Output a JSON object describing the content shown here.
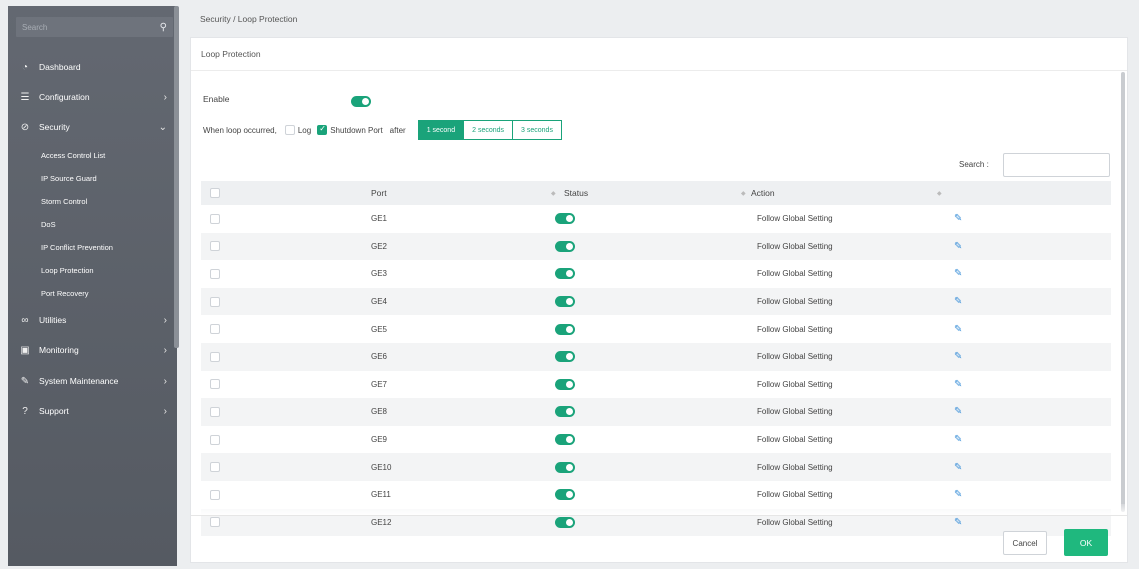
{
  "sidebar": {
    "search_placeholder": "Search",
    "items": [
      {
        "label": "Dashboard",
        "icon": "dashboard-icon",
        "glyph": "◔"
      },
      {
        "label": "Configuration",
        "icon": "sliders-icon",
        "glyph": "☰"
      },
      {
        "label": "Security",
        "icon": "shield-icon",
        "glyph": "⊘"
      },
      {
        "label": "Utilities",
        "icon": "utilities-icon",
        "glyph": "∞"
      },
      {
        "label": "Monitoring",
        "icon": "monitor-icon",
        "glyph": "▣"
      },
      {
        "label": "System Maintenance",
        "icon": "wrench-icon",
        "glyph": "✎"
      },
      {
        "label": "Support",
        "icon": "help-icon",
        "glyph": "?"
      }
    ],
    "security_sub": [
      "Access Control List",
      "IP Source Guard",
      "Storm Control",
      "DoS",
      "IP Conflict Prevention",
      "Loop Protection",
      "Port Recovery"
    ]
  },
  "breadcrumb": "Security / Loop Protection",
  "panel_title": "Loop Protection",
  "enable_label": "Enable",
  "loop": {
    "when_text": "When loop occurred,",
    "log_label": "Log",
    "shutdown_label": "Shutdown Port",
    "after_text": "after",
    "options": [
      "1 second",
      "2 seconds",
      "3 seconds"
    ],
    "selected": "1 second"
  },
  "search_label": "Search :",
  "table": {
    "headers": {
      "port": "Port",
      "status": "Status",
      "action": "Action"
    },
    "rows": [
      {
        "port": "GE1",
        "action": "Follow Global Setting"
      },
      {
        "port": "GE2",
        "action": "Follow Global Setting"
      },
      {
        "port": "GE3",
        "action": "Follow Global Setting"
      },
      {
        "port": "GE4",
        "action": "Follow Global Setting"
      },
      {
        "port": "GE5",
        "action": "Follow Global Setting"
      },
      {
        "port": "GE6",
        "action": "Follow Global Setting"
      },
      {
        "port": "GE7",
        "action": "Follow Global Setting"
      },
      {
        "port": "GE8",
        "action": "Follow Global Setting"
      },
      {
        "port": "GE9",
        "action": "Follow Global Setting"
      },
      {
        "port": "GE10",
        "action": "Follow Global Setting"
      },
      {
        "port": "GE11",
        "action": "Follow Global Setting"
      },
      {
        "port": "GE12",
        "action": "Follow Global Setting"
      }
    ]
  },
  "buttons": {
    "cancel": "Cancel",
    "ok": "OK"
  },
  "colors": {
    "accent": "#1aa37a",
    "ok_button": "#1fb87e",
    "edit_icon": "#3a8fd8"
  }
}
